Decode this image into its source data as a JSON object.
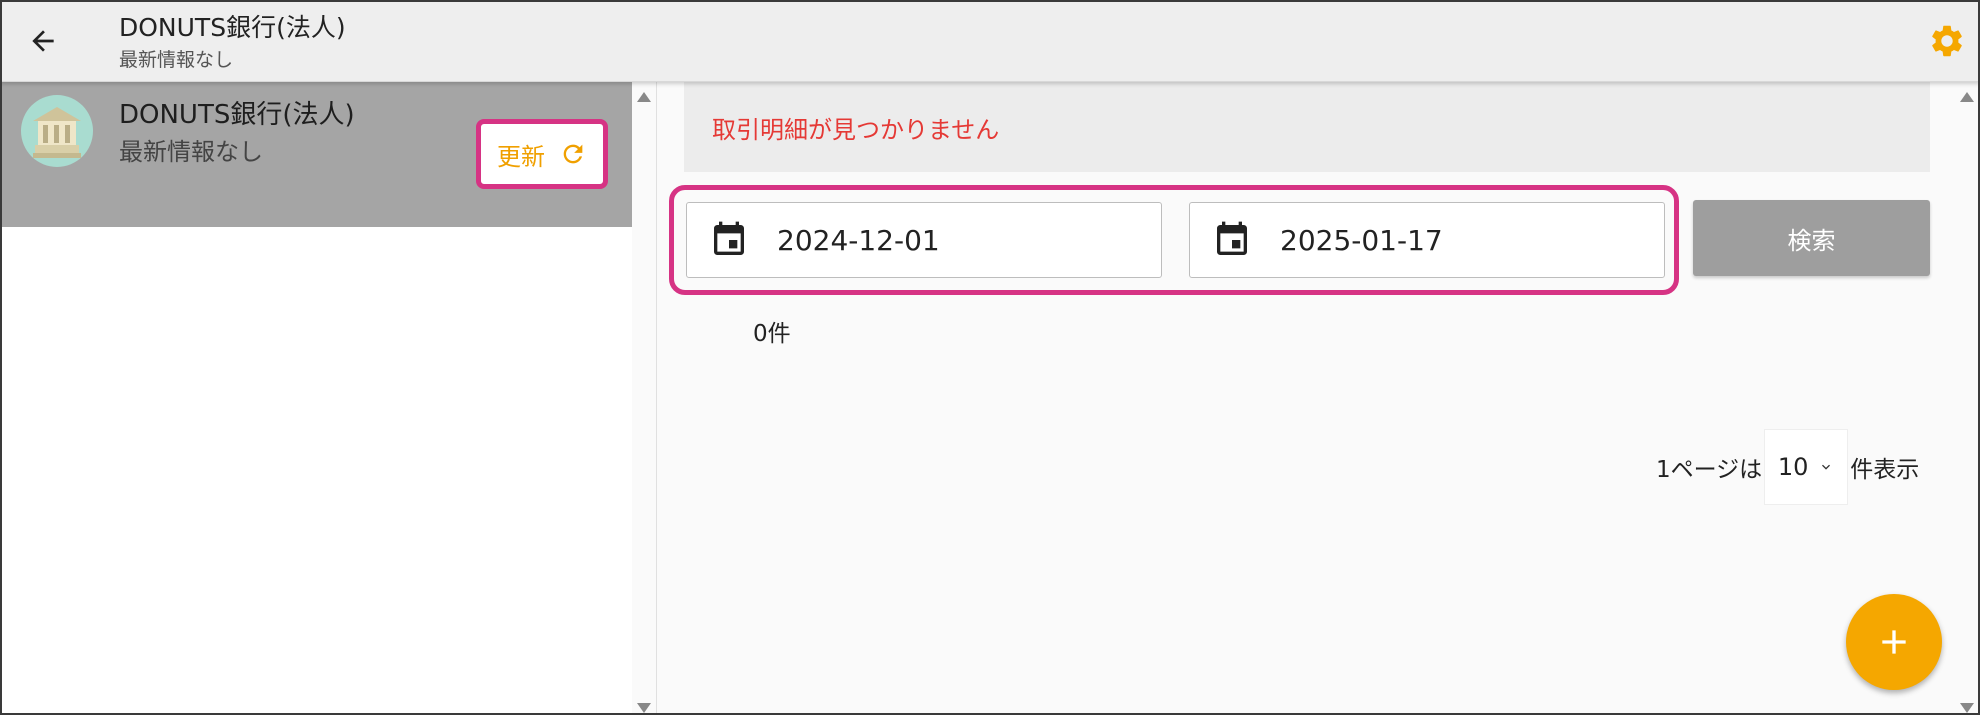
{
  "header": {
    "title": "DONUTS銀行(法人)",
    "subtitle": "最新情報なし",
    "back_icon": "arrow-left-icon",
    "settings_icon": "gear-icon",
    "settings_color": "#f5a700"
  },
  "sidebar": {
    "account": {
      "name": "DONUTS銀行(法人)",
      "status": "最新情報なし",
      "avatar_icon": "bank-building-icon",
      "update_label": "更新",
      "update_icon": "refresh-icon"
    }
  },
  "main": {
    "notice": "取引明細が見つかりません",
    "date_from": "2024-12-01",
    "date_to": "2025-01-17",
    "search_label": "検索",
    "count": "0件",
    "pager": {
      "prefix": "1ページは",
      "selected": "10",
      "suffix": "件表示"
    },
    "fab_icon": "plus-icon"
  },
  "colors": {
    "accent": "#f5a700",
    "highlight": "#d63384",
    "error": "#e53935",
    "selected_row": "#a5a5a5"
  }
}
